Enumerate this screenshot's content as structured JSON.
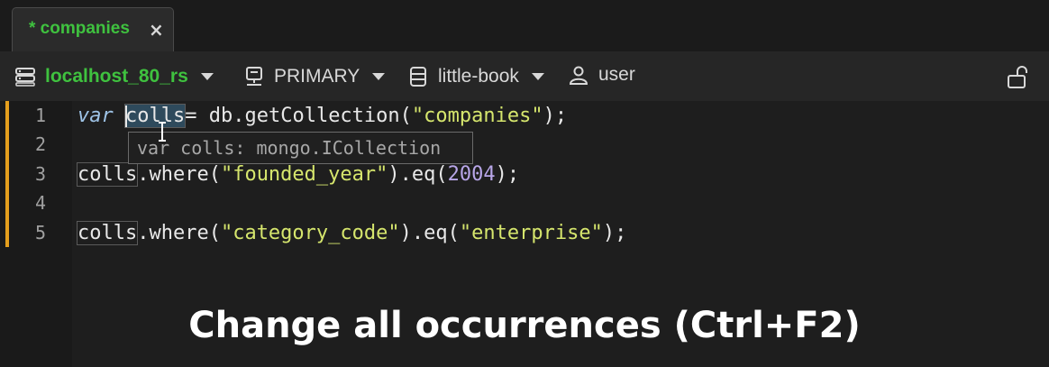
{
  "tab": {
    "label": "* companies",
    "close": "×"
  },
  "toolbar": {
    "connection": "localhost_80_rs",
    "member": "PRIMARY",
    "database": "little-book",
    "user": "user"
  },
  "editor": {
    "line_numbers": [
      "1",
      "2",
      "3",
      "4",
      "5"
    ],
    "line1": {
      "kw": "var",
      "var_a": "co",
      "var_b": "lls",
      "rest": "= db.getCollection(",
      "str": "\"companies\"",
      "end": ");"
    },
    "line3": {
      "var": "colls",
      "call": ".where(",
      "str": "\"founded_year\"",
      "mid": ").eq(",
      "num": "2004",
      "end": ");"
    },
    "line5": {
      "var": "colls",
      "call": ".where(",
      "str": "\"category_code\"",
      "mid": ").eq(",
      "str2": "\"enterprise\"",
      "end": ");"
    },
    "tooltip": "var colls: mongo.ICollection"
  },
  "caption": "Change all occurrences (Ctrl+F2)",
  "colors": {
    "accent_green": "#3fc23f",
    "modified_marker": "#e59f1d"
  }
}
